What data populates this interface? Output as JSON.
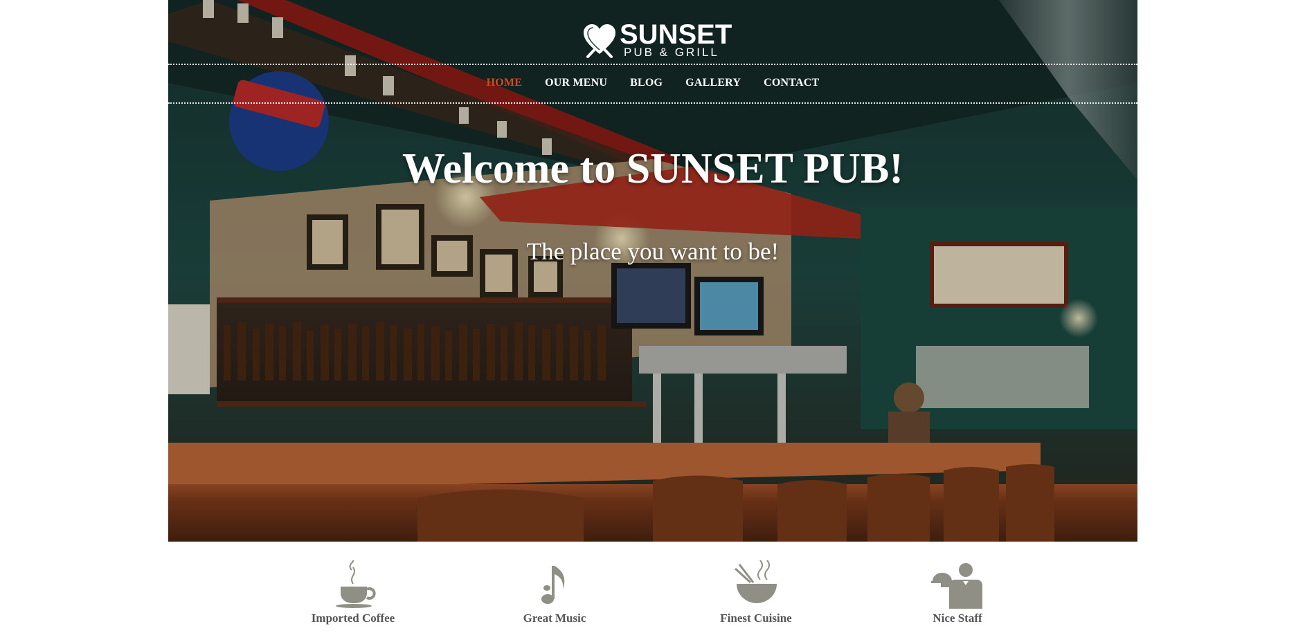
{
  "brand": {
    "name": "SUNSET",
    "tagline": "PUB & GRILL",
    "logo_icon": "heart-fork-knife-icon"
  },
  "nav": {
    "items": [
      {
        "label": "HOME",
        "active": true
      },
      {
        "label": "OUR MENU",
        "active": false
      },
      {
        "label": "BLOG",
        "active": false
      },
      {
        "label": "GALLERY",
        "active": false
      },
      {
        "label": "CONTACT",
        "active": false
      }
    ]
  },
  "hero": {
    "title": "Welcome to SUNSET PUB!",
    "subtitle": "The place you want to be!"
  },
  "features": [
    {
      "label": "Imported Coffee",
      "icon": "coffee-cup-icon"
    },
    {
      "label": "Great Music",
      "icon": "music-note-icon"
    },
    {
      "label": "Finest Cuisine",
      "icon": "noodle-bowl-icon"
    },
    {
      "label": "Nice Staff",
      "icon": "waiter-icon"
    }
  ],
  "colors": {
    "accent": "#e0451b",
    "nav_text": "#ffffff",
    "feature_icon": "#8f8f86",
    "feature_text": "#555555"
  }
}
